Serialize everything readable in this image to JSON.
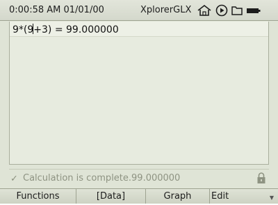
{
  "titlebar": {
    "datetime": "0:00:58 AM  01/01/00",
    "app_name": "XplorerGLX",
    "icons": [
      "home-icon",
      "play-icon",
      "folder-icon",
      "battery-icon"
    ]
  },
  "calculator": {
    "expression_before_cursor": "9*(9",
    "expression_after_cursor": "+3) = ",
    "result": "99.000000"
  },
  "status": {
    "message": "Calculation is complete.99.000000",
    "icons": [
      "check-icon",
      "lock-icon"
    ]
  },
  "softkeys": {
    "functions": "Functions",
    "data": "[Data]",
    "graph": "Graph",
    "edit": "Edit",
    "more_indicator": "▼"
  }
}
